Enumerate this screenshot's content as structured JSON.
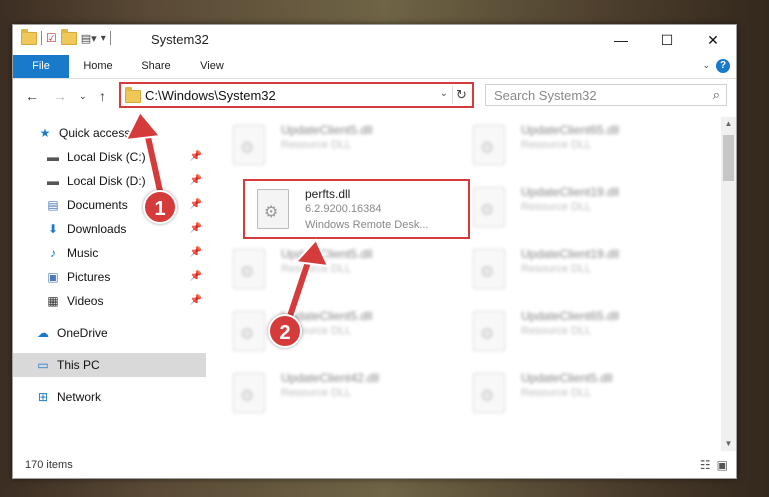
{
  "window": {
    "title": "System32",
    "controls": {
      "minimize": "—",
      "maximize": "☐",
      "close": "✕"
    }
  },
  "ribbon": {
    "tabs": [
      "File",
      "Home",
      "Share",
      "View"
    ],
    "help": "?"
  },
  "address": {
    "path": "C:\\Windows\\System32",
    "search_placeholder": "Search System32"
  },
  "nav": {
    "items": [
      {
        "label": "Quick access",
        "icon": "star-icon"
      },
      {
        "label": "Local Disk (C:)",
        "icon": "drive-icon",
        "pinned": true
      },
      {
        "label": "Local Disk (D:)",
        "icon": "drive-icon",
        "pinned": true
      },
      {
        "label": "Documents",
        "icon": "document-icon",
        "pinned": true
      },
      {
        "label": "Downloads",
        "icon": "download-icon",
        "pinned": true
      },
      {
        "label": "Music",
        "icon": "music-icon",
        "pinned": true
      },
      {
        "label": "Pictures",
        "icon": "pictures-icon",
        "pinned": true
      },
      {
        "label": "Videos",
        "icon": "video-icon",
        "pinned": true
      },
      {
        "label": "OneDrive",
        "icon": "cloud-icon"
      },
      {
        "label": "This PC",
        "icon": "computer-icon",
        "selected": true
      },
      {
        "label": "Network",
        "icon": "network-icon"
      }
    ]
  },
  "files": {
    "highlighted": {
      "name": "perfts.dll",
      "version": "6.2.9200.16384",
      "description": "Windows Remote Desk..."
    },
    "blurred": [
      {
        "name": "UpdateClient5.dll",
        "type": "Resource DLL"
      },
      {
        "name": "UpdateClient65.dll",
        "type": "Resource DLL"
      },
      {
        "name": "UpdateClient19.dll",
        "type": "Resource DLL"
      },
      {
        "name": "UpdateClient5.dll",
        "type": "Resource DLL"
      },
      {
        "name": "UpdateClient19.dll",
        "type": "Resource DLL"
      },
      {
        "name": "UpdateClient5.dll",
        "type": "Resource DLL"
      },
      {
        "name": "UpdateClient65.dll",
        "type": "Resource DLL"
      },
      {
        "name": "UpdateClient42.dll",
        "type": "Resource DLL"
      },
      {
        "name": "UpdateClient5.dll",
        "type": "Resource DLL"
      }
    ]
  },
  "status": {
    "items": "170 items"
  },
  "callouts": {
    "one": "1",
    "two": "2"
  },
  "colors": {
    "accent": "#1979ca",
    "callout": "#d63b3b"
  }
}
